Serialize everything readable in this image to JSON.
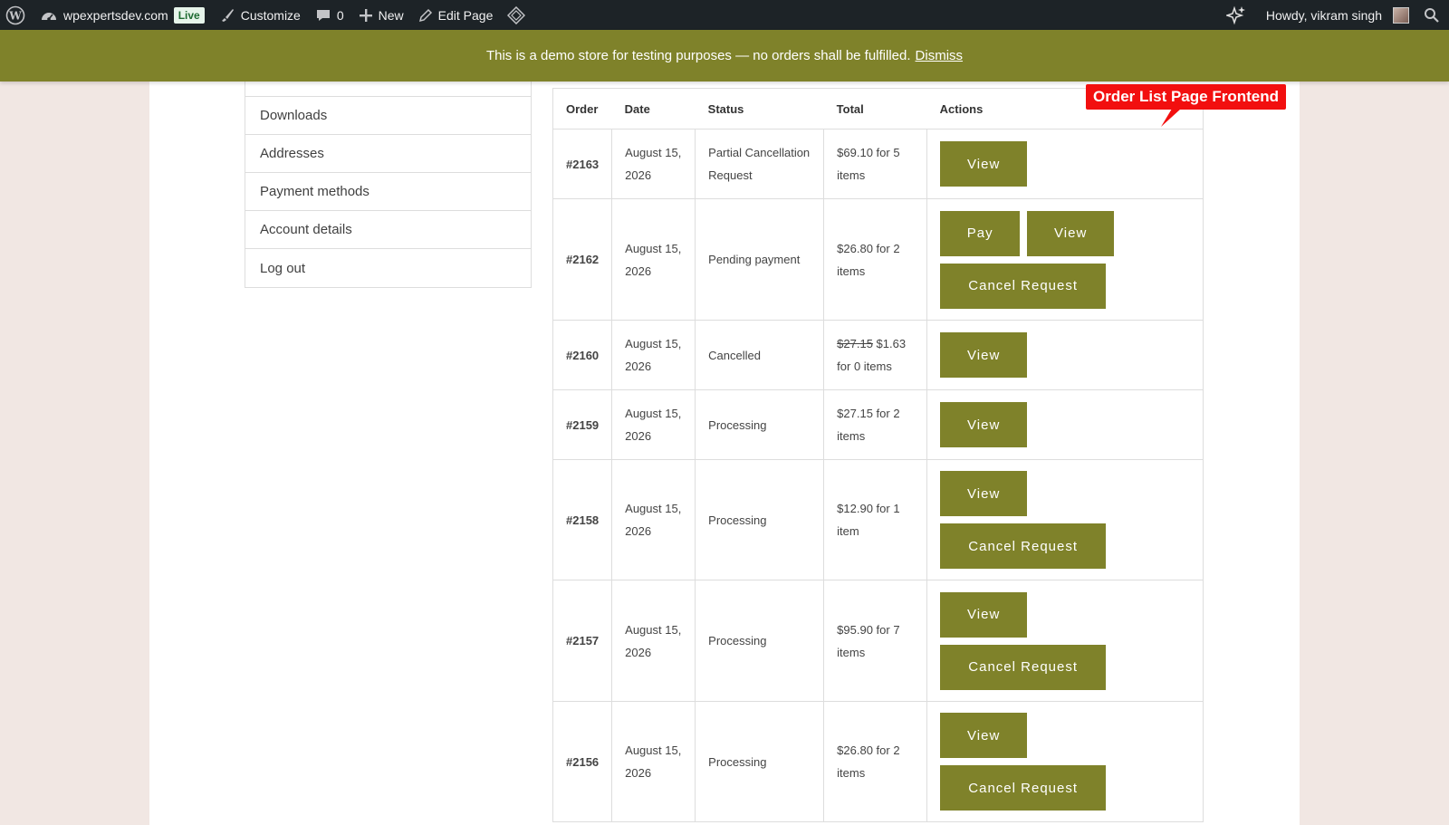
{
  "adminbar": {
    "site_name": "wpexpertsdev.com",
    "live_badge": "Live",
    "customize": "Customize",
    "comments_count": "0",
    "new": "New",
    "edit_page": "Edit Page",
    "howdy": "Howdy, vikram singh"
  },
  "notice": {
    "text": "This is a demo store for testing purposes — no orders shall be fulfilled.",
    "dismiss": "Dismiss"
  },
  "account_nav": {
    "items": [
      "Downloads",
      "Addresses",
      "Payment methods",
      "Account details",
      "Log out"
    ]
  },
  "orders_table": {
    "headers": [
      "Order",
      "Date",
      "Status",
      "Total",
      "Actions"
    ],
    "rows": [
      {
        "order": "#2163",
        "date": "August 15, 2026",
        "status": "Partial Cancellation Request",
        "total": "$69.10 for 5 items",
        "total_old": "",
        "actions": [
          "View"
        ]
      },
      {
        "order": "#2162",
        "date": "August 15, 2026",
        "status": "Pending payment",
        "total": "$26.80 for 2 items",
        "total_old": "",
        "actions": [
          "Pay",
          "View",
          "Cancel Request"
        ]
      },
      {
        "order": "#2160",
        "date": "August 15, 2026",
        "status": "Cancelled",
        "total": "$1.63 for 0 items",
        "total_old": "$27.15",
        "actions": [
          "View"
        ]
      },
      {
        "order": "#2159",
        "date": "August 15, 2026",
        "status": "Processing",
        "total": "$27.15 for 2 items",
        "total_old": "",
        "actions": [
          "View"
        ]
      },
      {
        "order": "#2158",
        "date": "August 15, 2026",
        "status": "Processing",
        "total": "$12.90 for 1 item",
        "total_old": "",
        "actions": [
          "View",
          "Cancel Request"
        ]
      },
      {
        "order": "#2157",
        "date": "August 15, 2026",
        "status": "Processing",
        "total": "$95.90 for 7 items",
        "total_old": "",
        "actions": [
          "View",
          "Cancel Request"
        ]
      },
      {
        "order": "#2156",
        "date": "August 15, 2026",
        "status": "Processing",
        "total": "$26.80 for 2 items",
        "total_old": "",
        "actions": [
          "View",
          "Cancel Request"
        ]
      }
    ]
  },
  "callout": {
    "text": "Order List Page Frontend"
  },
  "colors": {
    "brand": "#7f822a",
    "adminbar": "#1d2327",
    "callout": "#f20f0f",
    "page_bg": "#f1e7e3"
  },
  "icons": [
    "wordpress-icon",
    "dashboard-icon",
    "brush-icon",
    "comment-icon",
    "plus-icon",
    "pencil-icon",
    "diamond-icon",
    "sparkle-icon",
    "search-icon"
  ]
}
